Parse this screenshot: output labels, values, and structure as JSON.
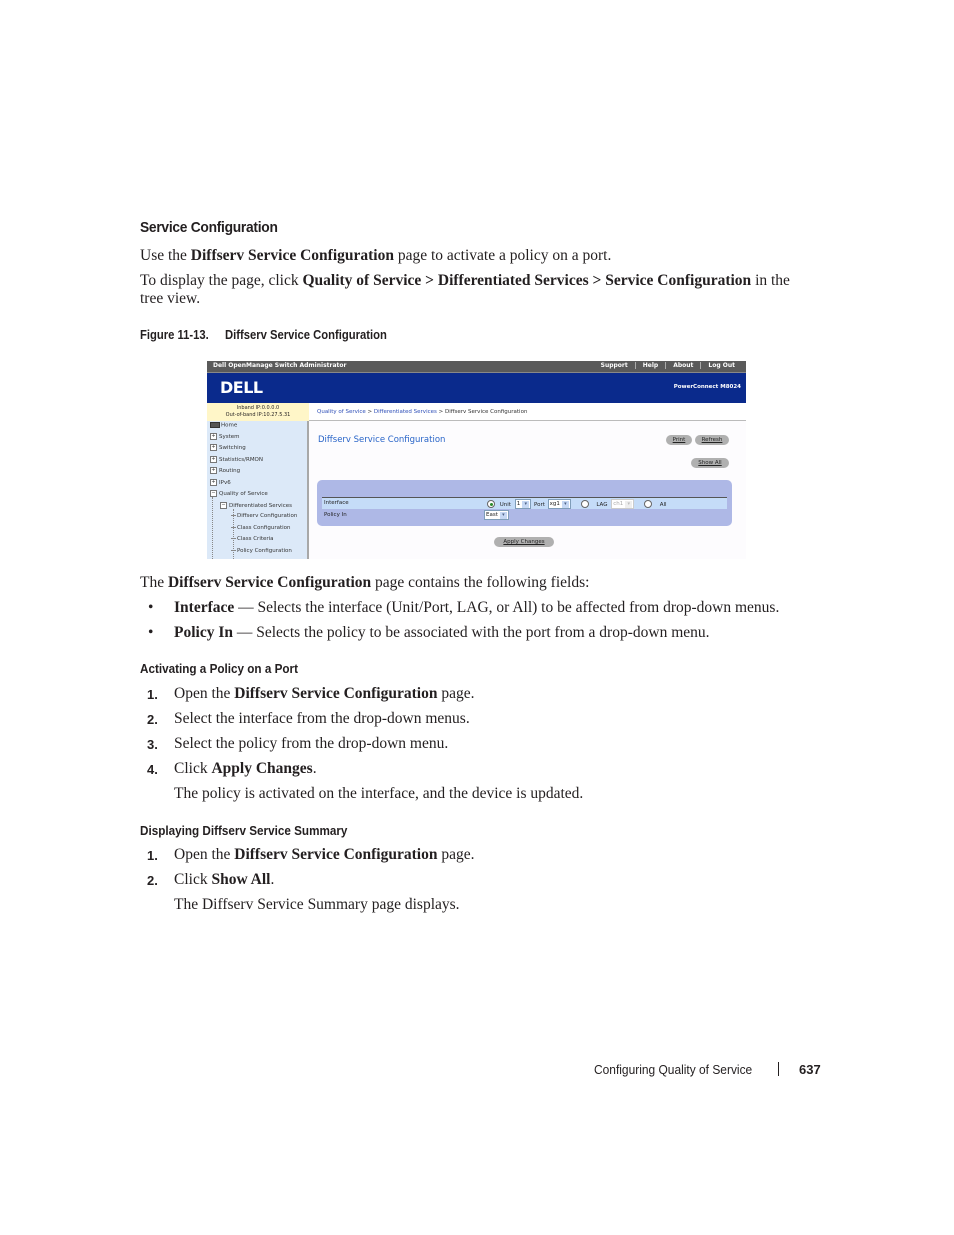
{
  "section": {
    "title": "Service Configuration",
    "intro": {
      "pre": "Use the ",
      "bold": "Diffserv Service Configuration",
      "post": " page to activate a policy on a port."
    },
    "navigation": {
      "pre": "To display the page, click ",
      "bold": "Quality of Service > Differentiated Services > Service Configuration",
      "post": " in the",
      "line2": "tree view."
    }
  },
  "figure": {
    "number": "Figure 11-13.",
    "title": "Diffserv Service Configuration",
    "app": {
      "window_title": "Dell OpenManage Switch Administrator",
      "top_nav": [
        "Support",
        "Help",
        "About",
        "Log Out"
      ],
      "logo": "DELL",
      "model": "PowerConnect M8024",
      "ip_info": {
        "inband": "Inband IP:0.0.0.0",
        "out_of_band": "Out-of-band IP:10.27.5.31"
      },
      "breadcrumb": {
        "items": [
          "Quality of Service",
          "Differentiated Services"
        ],
        "separator": " > ",
        "current": "Diffserv Service Configuration"
      },
      "tree": [
        {
          "label": "Home",
          "type": "home"
        },
        {
          "label": "System",
          "type": "expandable",
          "expanded": false
        },
        {
          "label": "Switching",
          "type": "expandable",
          "expanded": false
        },
        {
          "label": "Statistics/RMON",
          "type": "expandable",
          "expanded": false
        },
        {
          "label": "Routing",
          "type": "expandable",
          "expanded": false
        },
        {
          "label": "IPv6",
          "type": "expandable",
          "expanded": false
        },
        {
          "label": "Quality of Service",
          "type": "expandable",
          "expanded": true
        },
        {
          "label": "Differentiated Services",
          "type": "expandable",
          "expanded": true
        },
        {
          "label": "Diffserv Configuration",
          "type": "leaf"
        },
        {
          "label": "Class Configuration",
          "type": "leaf"
        },
        {
          "label": "Class Criteria",
          "type": "leaf"
        },
        {
          "label": "Policy Configuration",
          "type": "leaf"
        }
      ],
      "page_title": "Diffserv Service Configuration",
      "buttons": {
        "print": "Print",
        "refresh": "Refresh",
        "show_all": "Show All",
        "apply": "Apply Changes"
      },
      "form": {
        "interface_label": "Interface",
        "policy_in_label": "Policy In",
        "interface_mode": "unit",
        "unit_label": "Unit",
        "unit_value": "1",
        "port_label": "Port",
        "port_value": "xg1",
        "lag_label": "LAG",
        "lag_value": "ch1",
        "all_label": "All",
        "policy_in_value": "East"
      }
    }
  },
  "fields_intro": {
    "pre": "The ",
    "bold": "Diffserv Service Configuration",
    "post": " page contains the following fields:"
  },
  "fields": [
    {
      "name": "Interface",
      "desc": " — Selects the interface (Unit/Port, LAG, or All) to be affected from drop-down menus."
    },
    {
      "name": "Policy In",
      "desc": " — Selects the policy to be associated with the port from a drop-down menu."
    }
  ],
  "activating": {
    "title": "Activating a Policy on a Port",
    "steps": [
      {
        "num": "1.",
        "pre": "Open the ",
        "bold": "Diffserv Service Configuration",
        "post": " page."
      },
      {
        "num": "2.",
        "pre": "Select the interface from the drop-down menus.",
        "bold": "",
        "post": ""
      },
      {
        "num": "3.",
        "pre": "Select the policy from the drop-down menu.",
        "bold": "",
        "post": ""
      },
      {
        "num": "4.",
        "pre": "Click ",
        "bold": "Apply Changes",
        "post": "."
      }
    ],
    "result": "The policy is activated on the interface, and the device is updated."
  },
  "displaying": {
    "title": "Displaying Diffserv Service Summary",
    "steps": [
      {
        "num": "1.",
        "pre": "Open the ",
        "bold": "Diffserv Service Configuration",
        "post": " page."
      },
      {
        "num": "2.",
        "pre": "Click ",
        "bold": "Show All",
        "post": "."
      }
    ],
    "result": "The Diffserv Service Summary page displays."
  },
  "footer": {
    "chapter": "Configuring Quality of Service",
    "page": "637"
  }
}
